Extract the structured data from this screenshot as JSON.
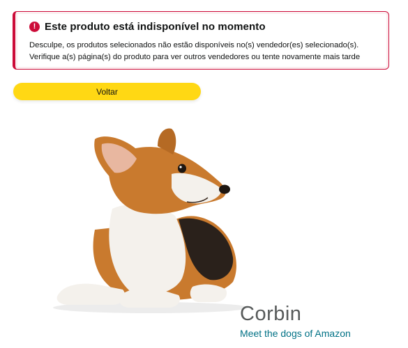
{
  "alert": {
    "icon": "exclamation-icon",
    "icon_glyph": "!",
    "title": "Este produto está indisponível no momento",
    "message": "Desculpe, os produtos selecionados não estão disponíveis no(s) vendedor(es) selecionado(s). Verifique a(s) página(s) do produto para ver outros vendedores ou tente novamente mais tarde",
    "color": "#cc0c39"
  },
  "back_button": {
    "label": "Voltar",
    "color": "#ffd814"
  },
  "dog": {
    "name": "Corbin",
    "link_text": "Meet the dogs of Amazon",
    "link_color": "#007185"
  }
}
